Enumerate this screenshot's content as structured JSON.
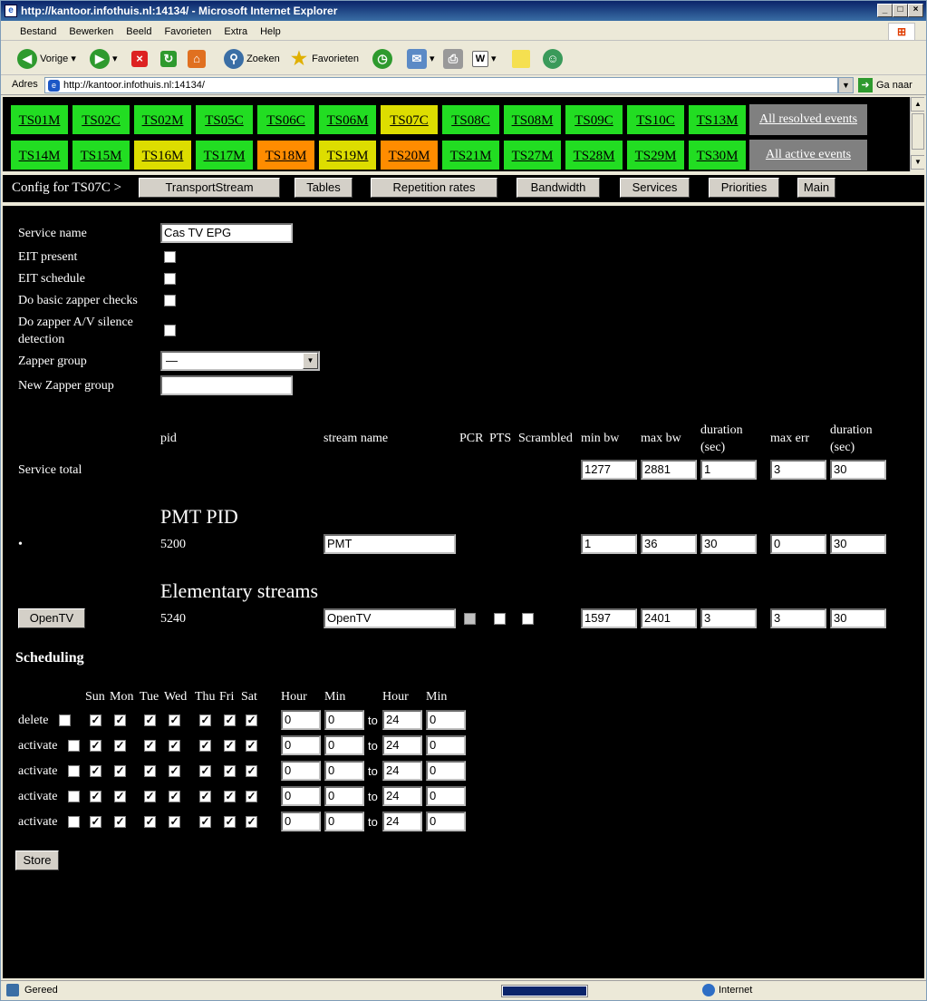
{
  "window": {
    "title": "http://kantoor.infothuis.nl:14134/ - Microsoft Internet Explorer"
  },
  "menu": [
    "Bestand",
    "Bewerken",
    "Beeld",
    "Favorieten",
    "Extra",
    "Help"
  ],
  "toolbar": {
    "back": "Vorige",
    "search": "Zoeken",
    "favorites": "Favorieten"
  },
  "address": {
    "label": "Adres",
    "url": "http://kantoor.infothuis.nl:14134/",
    "go": "Ga naar"
  },
  "streams_row1": [
    {
      "name": "TS01M",
      "color": "#22dd22"
    },
    {
      "name": "TS02C",
      "color": "#22dd22"
    },
    {
      "name": "TS02M",
      "color": "#22dd22"
    },
    {
      "name": "TS05C",
      "color": "#22dd22"
    },
    {
      "name": "TS06C",
      "color": "#22dd22"
    },
    {
      "name": "TS06M",
      "color": "#22dd22"
    },
    {
      "name": "TS07C",
      "color": "#dddd00"
    },
    {
      "name": "TS08C",
      "color": "#22dd22"
    },
    {
      "name": "TS08M",
      "color": "#22dd22"
    },
    {
      "name": "TS09C",
      "color": "#22dd22"
    },
    {
      "name": "TS10C",
      "color": "#22dd22"
    },
    {
      "name": "TS13M",
      "color": "#22dd22"
    }
  ],
  "streams_row2": [
    {
      "name": "TS14M",
      "color": "#22dd22"
    },
    {
      "name": "TS15M",
      "color": "#22dd22"
    },
    {
      "name": "TS16M",
      "color": "#dddd00"
    },
    {
      "name": "TS17M",
      "color": "#22dd22"
    },
    {
      "name": "TS18M",
      "color": "#ff8c00"
    },
    {
      "name": "TS19M",
      "color": "#dddd00"
    },
    {
      "name": "TS20M",
      "color": "#ff8c00"
    },
    {
      "name": "TS21M",
      "color": "#22dd22"
    },
    {
      "name": "TS27M",
      "color": "#22dd22"
    },
    {
      "name": "TS28M",
      "color": "#22dd22"
    },
    {
      "name": "TS29M",
      "color": "#22dd22"
    },
    {
      "name": "TS30M",
      "color": "#22dd22"
    }
  ],
  "events": {
    "resolved": "All resolved events",
    "active": "All active events"
  },
  "nav": {
    "label": "Config for TS07C >",
    "buttons": [
      "TransportStream",
      "Tables",
      "Repetition rates",
      "Bandwidth",
      "Services",
      "Priorities",
      "Main"
    ]
  },
  "service": {
    "name_label": "Service name",
    "name_value": "Cas TV EPG",
    "eit_present": "EIT present",
    "eit_schedule": "EIT schedule",
    "zapper_checks": "Do basic zapper checks",
    "av_silence": "Do zapper A/V silence detection",
    "zapper_group": "Zapper group",
    "zapper_group_value": "—",
    "new_zapper_group": "New Zapper group"
  },
  "table": {
    "headers": {
      "pid": "pid",
      "stream_name": "stream name",
      "pcr": "PCR",
      "pts": "PTS",
      "scrambled": "Scrambled",
      "min_bw": "min bw",
      "max_bw": "max bw",
      "duration1": "duration (sec)",
      "max_err": "max err",
      "duration2": "duration (sec)"
    },
    "service_total": {
      "label": "Service total",
      "min_bw": "1277",
      "max_bw": "2881",
      "duration1": "1",
      "max_err": "3",
      "duration2": "30"
    },
    "pmt_title": "PMT PID",
    "pmt": {
      "bullet": "•",
      "pid": "5200",
      "name": "PMT",
      "min_bw": "1",
      "max_bw": "36",
      "duration1": "30",
      "max_err": "0",
      "duration2": "30"
    },
    "es_title": "Elementary streams",
    "es": {
      "button": "OpenTV",
      "pid": "5240",
      "name": "OpenTV",
      "min_bw": "1597",
      "max_bw": "2401",
      "duration1": "3",
      "max_err": "3",
      "duration2": "30"
    }
  },
  "scheduling": {
    "title": "Scheduling",
    "days": [
      "Sun",
      "Mon",
      "Tue",
      "Wed",
      "Thu",
      "Fri",
      "Sat"
    ],
    "hour": "Hour",
    "min": "Min",
    "to": "to",
    "rows": [
      {
        "action": "delete",
        "from_hour": "0",
        "from_min": "0",
        "to_hour": "24",
        "to_min": "0"
      },
      {
        "action": "activate",
        "from_hour": "0",
        "from_min": "0",
        "to_hour": "24",
        "to_min": "0"
      },
      {
        "action": "activate",
        "from_hour": "0",
        "from_min": "0",
        "to_hour": "24",
        "to_min": "0"
      },
      {
        "action": "activate",
        "from_hour": "0",
        "from_min": "0",
        "to_hour": "24",
        "to_min": "0"
      },
      {
        "action": "activate",
        "from_hour": "0",
        "from_min": "0",
        "to_hour": "24",
        "to_min": "0"
      }
    ],
    "store": "Store"
  },
  "status": {
    "left": "Gereed",
    "zone": "Internet"
  }
}
